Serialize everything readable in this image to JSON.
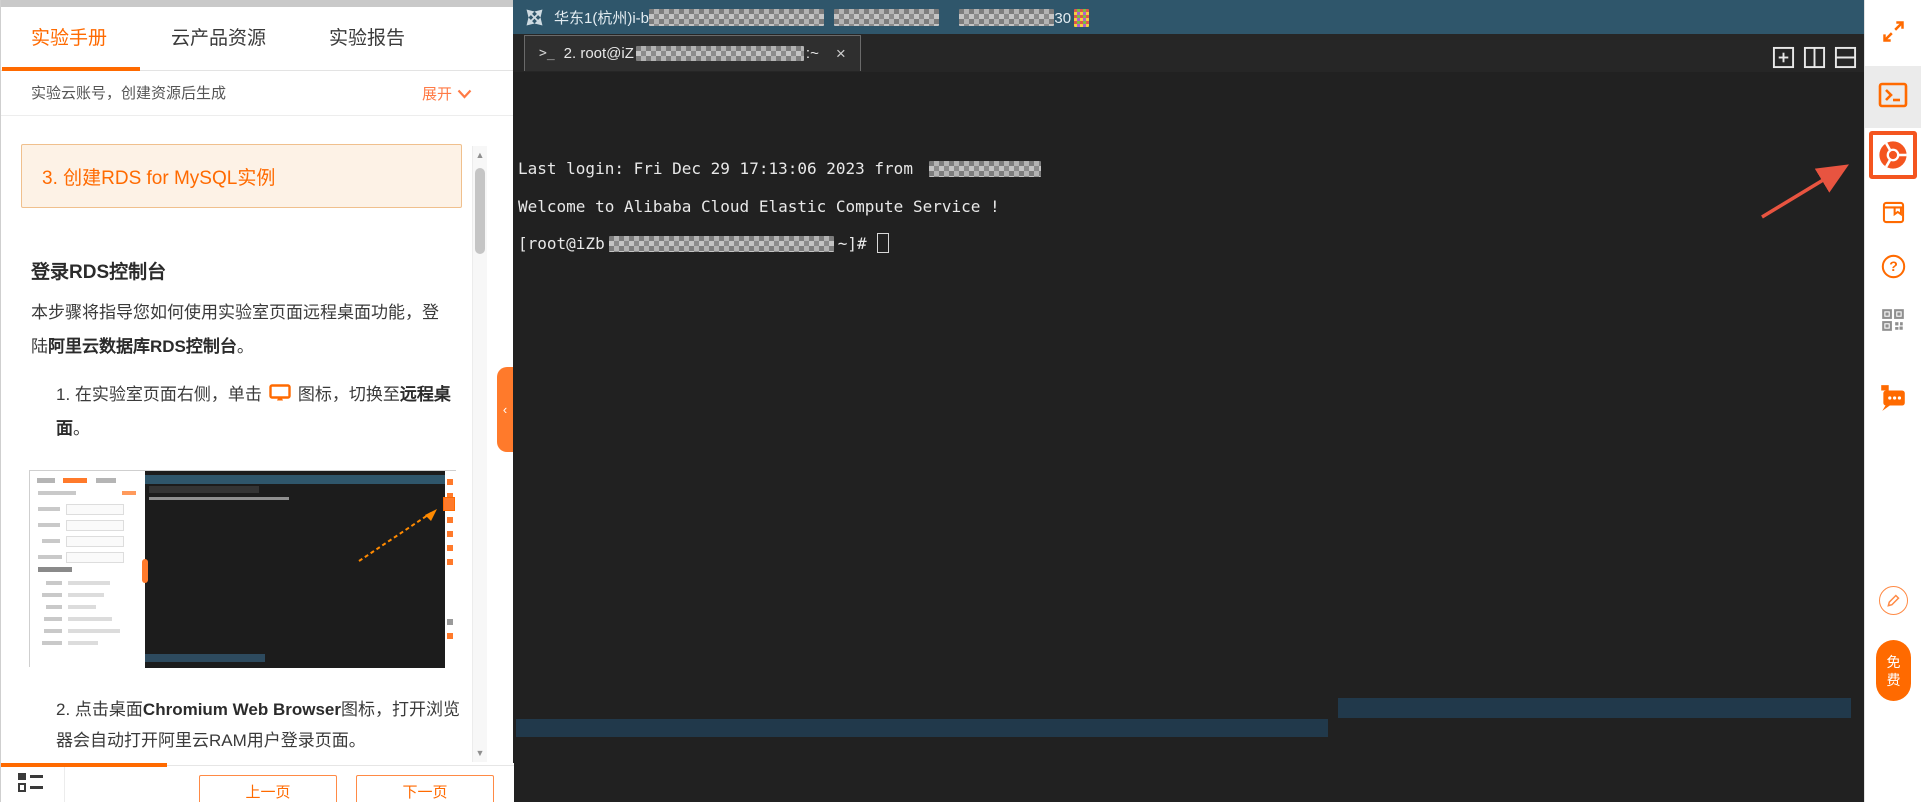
{
  "left_panel": {
    "tabs": [
      {
        "label": "实验手册",
        "active": true
      },
      {
        "label": "云产品资源",
        "active": false
      },
      {
        "label": "实验报告",
        "active": false
      }
    ],
    "note": "实验云账号，创建资源后生成",
    "expand_label": "展开",
    "section_title": "3. 创建RDS for MySQL实例",
    "article": {
      "heading": "登录RDS控制台",
      "intro_prefix": "本步骤将指导您如何使用实验室页面远程桌面功能，登陆",
      "intro_bold": "阿里云数据库RDS控制台",
      "intro_suffix": "。",
      "step1_num": "1.",
      "step1_before_icon": "在实验室页面右侧，单击",
      "step1_after_icon": "图标，切换至",
      "step1_bold": "远程桌面",
      "step1_suffix": "。",
      "step2_num": "2.",
      "step2_prefix": "点击桌面",
      "step2_bold": "Chromium Web Browser",
      "step2_suffix": "图标，打开浏览器会自动打开阿里云RAM用户登录页面。"
    },
    "footer": {
      "prev_label": "上一页",
      "next_label": "下一页"
    }
  },
  "terminal": {
    "header": {
      "region_prefix": "华东1(杭州)i-b",
      "visible_suffix": "30"
    },
    "tab": {
      "glyph": ">_",
      "title_prefix": "2. root@iZ",
      "title_suffix": ":~",
      "close": "×"
    },
    "window_controls": [
      "new-terminal",
      "split-vertical",
      "split-horizontal"
    ],
    "lines": {
      "last_login_prefix": "Last login: Fri Dec 29 17:13:06 2023 from",
      "welcome": "Welcome to Alibaba Cloud Elastic Compute Service !",
      "prompt_prefix": "[root@iZb",
      "prompt_suffix": "~]#"
    }
  },
  "right_sidebar": {
    "icons": [
      {
        "name": "fullscreen-icon"
      },
      {
        "name": "web-terminal-icon",
        "selected": true
      },
      {
        "name": "remote-desktop-chrome-icon",
        "highlighted": true
      },
      {
        "name": "manual-book-icon"
      },
      {
        "name": "help-icon"
      },
      {
        "name": "qr-code-icon"
      },
      {
        "name": "chat-robot-icon"
      },
      {
        "name": "feedback-pencil-icon"
      }
    ],
    "free_badge": {
      "line1": "免",
      "line2": "费"
    }
  },
  "colors": {
    "accent_orange": "#ff6a00",
    "chrome_highlight": "#f4551f",
    "terminal_header": "#2f566b",
    "terminal_background": "#212121",
    "selection_highlight": "#21394b",
    "annotation_arrow": "#e85440",
    "section_box_bg": "#fdf2e6",
    "section_box_border": "#f0c08d"
  }
}
